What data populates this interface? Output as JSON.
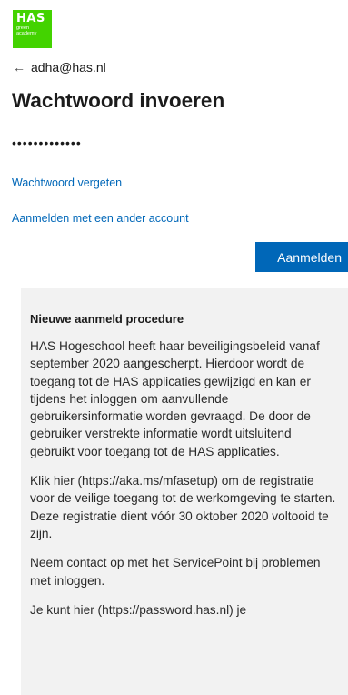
{
  "logo": {
    "big": "HAS",
    "small_line1": "green",
    "small_line2": "academy"
  },
  "header": {
    "back_icon": "left-arrow-icon",
    "account": "adha@has.nl"
  },
  "title": "Wachtwoord invoeren",
  "password": {
    "masked_value": "•••••••••••••"
  },
  "links": {
    "forgot": "Wachtwoord vergeten",
    "other_account": "Aanmelden met een ander account"
  },
  "submit_label": "Aanmelden",
  "colors": {
    "accent": "#0067b8",
    "logo_bg": "#43d300",
    "panel_bg": "#f2f2f2"
  },
  "notice": {
    "heading": "Nieuwe aanmeld procedure",
    "paragraphs": [
      "HAS Hogeschool heeft haar beveiligingsbeleid vanaf september 2020 aangescherpt. Hierdoor wordt de toegang tot de HAS applicaties gewijzigd en kan er tijdens het inloggen om aanvullende gebruikersinformatie worden gevraagd. De door de gebruiker verstrekte informatie wordt uitsluitend gebruikt voor toegang tot de HAS applicaties.",
      "Klik hier (https://aka.ms/mfasetup) om de registratie voor de veilige toegang tot de werkomgeving te starten. Deze registratie dient vóór 30 oktober 2020 voltooid te zijn.",
      "Neem contact op met het ServicePoint bij problemen met inloggen.",
      "Je kunt hier (https://password.has.nl) je"
    ]
  }
}
